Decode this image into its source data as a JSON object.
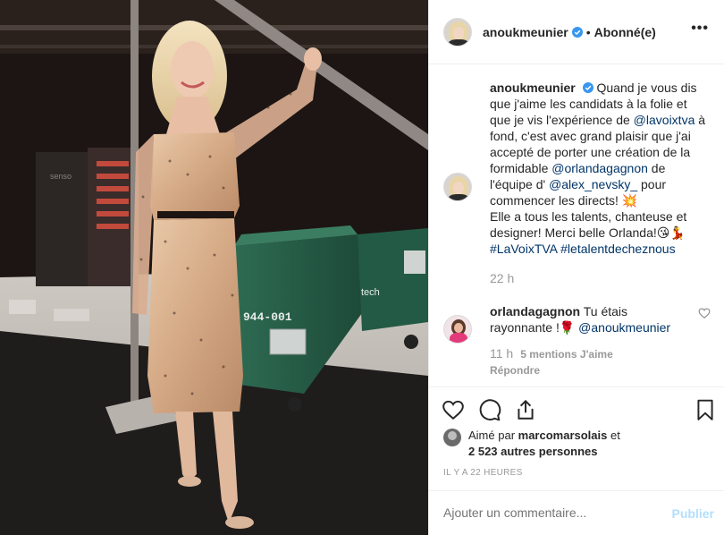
{
  "header": {
    "username": "anoukmeunier",
    "separator": "•",
    "follow_status": "Abonné(e)",
    "more_icon": "more-horizontal-icon"
  },
  "caption": {
    "username": "anoukmeunier",
    "text_1": "Quand je vous dis que j'aime les candidats à la folie et que je vis l'expérience de ",
    "mention_1": "@lavoixtva",
    "text_2": " à fond, c'est avec grand plaisir que j'ai accepté de porter une création de la formidable ",
    "mention_2": "@orlandagagnon",
    "text_3": " de l'équipe d' ",
    "mention_3": "@alex_nevsky_",
    "text_4": " pour commencer les directs! 💥",
    "text_5": "Elle a tous les talents, chanteuse et designer! Merci belle Orlanda!😘💃",
    "hashtag_1": "#LaVoixTVA",
    "hashtag_2": "#letalentdecheznous",
    "time": "22 h"
  },
  "comment": {
    "username": "orlandagagnon",
    "text": "Tu étais rayonnante !🌹",
    "mention": "@anoukmeunier",
    "time": "11 h",
    "likes": "5 mentions J'aime",
    "reply": "Répondre"
  },
  "actions": {
    "like_icon": "heart-icon",
    "comment_icon": "comment-icon",
    "share_icon": "share-icon",
    "save_icon": "bookmark-icon"
  },
  "likes": {
    "prefix": "Aimé par ",
    "user": "marcomarsolais",
    "middle": " et",
    "others": "2 523 autres personnes"
  },
  "timestamp": "Il y a 22 heures",
  "add_comment": {
    "placeholder": "Ajouter un commentaire...",
    "publish": "Publier"
  },
  "photo": {
    "case_label": "944-001",
    "case_label_2": "tech",
    "rack_label": "senso"
  },
  "colors": {
    "link": "#003569",
    "verified": "#3897f0",
    "muted": "#999999",
    "publish_disabled": "#b2dffc"
  }
}
